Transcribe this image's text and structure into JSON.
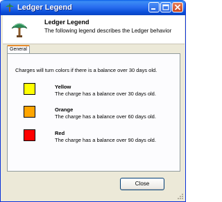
{
  "window": {
    "title": "Ledger Legend"
  },
  "header": {
    "title": "Ledger Legend",
    "description": "The following legend describes the Ledger behavior"
  },
  "tabs": [
    {
      "label": "General"
    }
  ],
  "panel": {
    "intro": "Charges will turn colors if there is a balance over 30 days old.",
    "legend": [
      {
        "name": "Yellow",
        "description": "The charge has a balance over 30 days old.",
        "color": "#ffff00"
      },
      {
        "name": "Orange",
        "description": "The charge has a balance over 60 days old.",
        "color": "#ffa500"
      },
      {
        "name": "Red",
        "description": "The charge has a balance over 90 days old.",
        "color": "#ff0000"
      }
    ]
  },
  "footer": {
    "close_label": "Close"
  },
  "titlebar_buttons": {
    "minimize": "minimize-icon",
    "maximize": "maximize-icon",
    "close": "close-icon"
  }
}
